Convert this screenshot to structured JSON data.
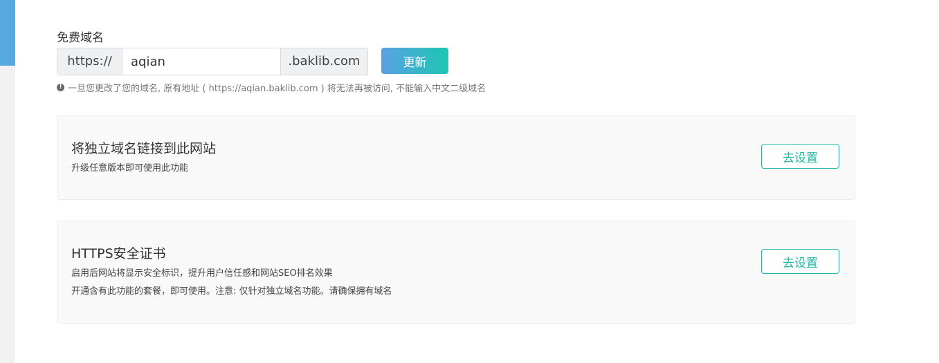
{
  "free_domain": {
    "title": "免费域名",
    "prefix": "https://",
    "subdomain_value": "aqian",
    "suffix": ".baklib.com",
    "update_label": "更新",
    "notice": "一旦您更改了您的域名, 原有地址 ( https://aqian.baklib.com ) 将无法再被访问, 不能输入中文二级域名",
    "notice_icon": "exclamation-circle-icon"
  },
  "custom_domain_card": {
    "title": "将独立域名链接到此网站",
    "description": "升级任意版本即可使用此功能",
    "button_label": "去设置"
  },
  "https_card": {
    "title": "HTTPS安全证书",
    "description_1": "启用后网站将显示安全标识，提升用户信任感和网站SEO排名效果",
    "description_2": "开通含有此功能的套餐，即可使用。注意: 仅针对独立域名功能。请确保拥有域名",
    "button_label": "去设置"
  },
  "colors": {
    "accent_blue": "#56a8e0",
    "accent_teal": "#20b8a8"
  }
}
